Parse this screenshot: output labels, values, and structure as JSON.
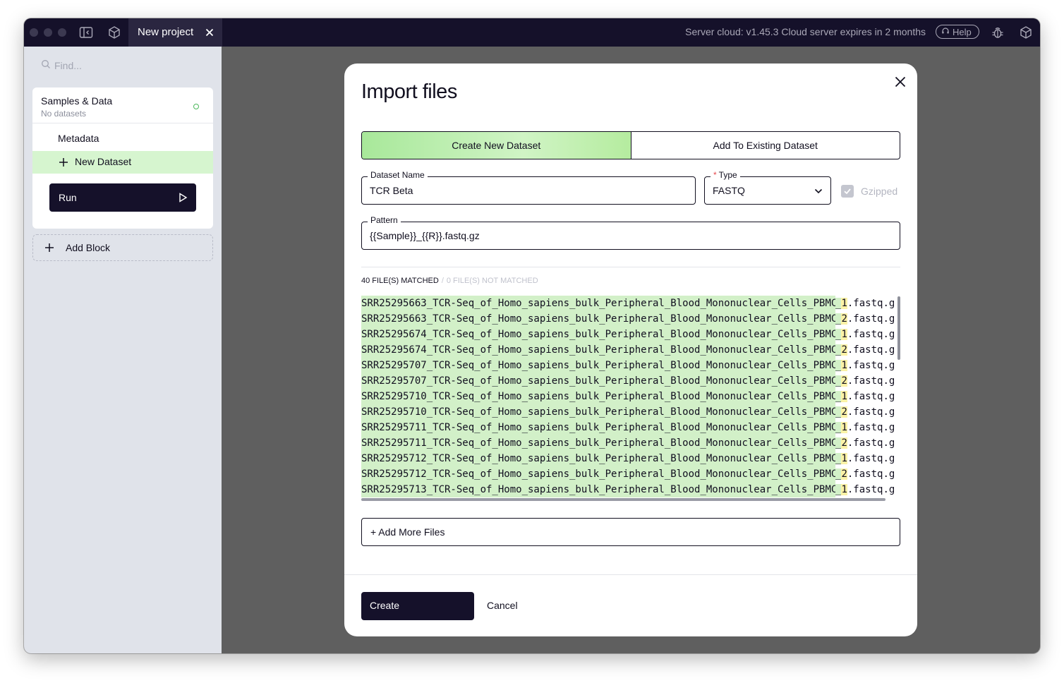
{
  "titlebar": {
    "tab_title": "New project",
    "server_status": "Server cloud: v1.45.3 Cloud server expires in 2 months",
    "help_label": "Help",
    "icons": [
      "sidebar-toggle-icon",
      "cube-icon",
      "close-icon",
      "headset-icon",
      "bug-icon",
      "package-icon"
    ]
  },
  "sidebar": {
    "search_placeholder": "Find...",
    "block": {
      "title": "Samples & Data",
      "subtitle": "No datasets",
      "items": [
        "Metadata",
        "New Dataset"
      ],
      "run_label": "Run"
    },
    "add_block_label": "Add Block"
  },
  "modal": {
    "title": "Import files",
    "mode_options": [
      "Create New Dataset",
      "Add To Existing Dataset"
    ],
    "active_mode": "Create New Dataset",
    "dataset_name": {
      "label": "Dataset Name",
      "value": "TCR Beta"
    },
    "type": {
      "label": "Type",
      "required_marker": "*",
      "value": "FASTQ"
    },
    "gzipped": {
      "label": "Gzipped",
      "checked": true,
      "disabled": true
    },
    "pattern": {
      "label": "Pattern",
      "value": "{{Sample}}_{{R}}.fastq.gz"
    },
    "match_summary": {
      "matched": "40 FILE(S) MATCHED",
      "separator": "/",
      "not_matched": "0 FILE(S) NOT MATCHED"
    },
    "files": [
      {
        "base": "SRR25295663_TCR-Seq_of_Homo_sapiens_bulk_Peripheral_Blood_Mononuclear_Cells_PBMC_",
        "r": "_1",
        "ext": ".fastq.g"
      },
      {
        "base": "SRR25295663_TCR-Seq_of_Homo_sapiens_bulk_Peripheral_Blood_Mononuclear_Cells_PBMC_",
        "r": "_2",
        "ext": ".fastq.g"
      },
      {
        "base": "SRR25295674_TCR-Seq_of_Homo_sapiens_bulk_Peripheral_Blood_Mononuclear_Cells_PBMC_",
        "r": "_1",
        "ext": ".fastq.g"
      },
      {
        "base": "SRR25295674_TCR-Seq_of_Homo_sapiens_bulk_Peripheral_Blood_Mononuclear_Cells_PBMC_",
        "r": "_2",
        "ext": ".fastq.g"
      },
      {
        "base": "SRR25295707_TCR-Seq_of_Homo_sapiens_bulk_Peripheral_Blood_Mononuclear_Cells_PBMC_",
        "r": "_1",
        "ext": ".fastq.g"
      },
      {
        "base": "SRR25295707_TCR-Seq_of_Homo_sapiens_bulk_Peripheral_Blood_Mononuclear_Cells_PBMC_",
        "r": "_2",
        "ext": ".fastq.g"
      },
      {
        "base": "SRR25295710_TCR-Seq_of_Homo_sapiens_bulk_Peripheral_Blood_Mononuclear_Cells_PBMC_",
        "r": "_1",
        "ext": ".fastq.g"
      },
      {
        "base": "SRR25295710_TCR-Seq_of_Homo_sapiens_bulk_Peripheral_Blood_Mononuclear_Cells_PBMC_",
        "r": "_2",
        "ext": ".fastq.g"
      },
      {
        "base": "SRR25295711_TCR-Seq_of_Homo_sapiens_bulk_Peripheral_Blood_Mononuclear_Cells_PBMC_",
        "r": "_1",
        "ext": ".fastq.g"
      },
      {
        "base": "SRR25295711_TCR-Seq_of_Homo_sapiens_bulk_Peripheral_Blood_Mononuclear_Cells_PBMC_",
        "r": "_2",
        "ext": ".fastq.g"
      },
      {
        "base": "SRR25295712_TCR-Seq_of_Homo_sapiens_bulk_Peripheral_Blood_Mononuclear_Cells_PBMC_",
        "r": "_1",
        "ext": ".fastq.g"
      },
      {
        "base": "SRR25295712_TCR-Seq_of_Homo_sapiens_bulk_Peripheral_Blood_Mononuclear_Cells_PBMC_",
        "r": "_2",
        "ext": ".fastq.g"
      },
      {
        "base": "SRR25295713_TCR-Seq_of_Homo_sapiens_bulk_Peripheral_Blood_Mononuclear_Cells_PBMC_",
        "r": "_1",
        "ext": ".fastq.g"
      }
    ],
    "add_more_label": "+ Add More Files",
    "create_label": "Create",
    "cancel_label": "Cancel"
  },
  "colors": {
    "titlebar_bg": "#15112a",
    "sidebar_bg": "#e0e3ea",
    "overlay_bg": "#5f5f5f",
    "match_green": "#d2f0c8",
    "r_highlight": "#fbf2a6",
    "status_green": "#4cb85c",
    "required_red": "#e5484d"
  }
}
